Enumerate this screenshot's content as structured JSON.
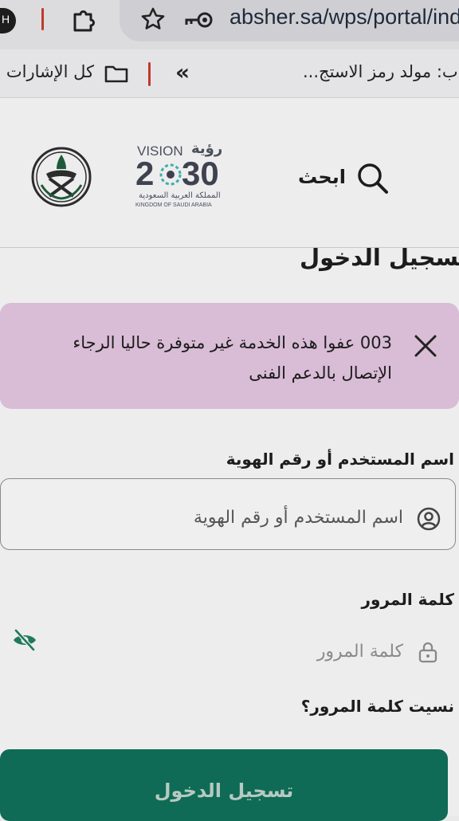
{
  "browser": {
    "profile_letter": "H",
    "url": "absher.sa/wps/portal/indi",
    "bookmarks_all_label": "كل الإشارات ا",
    "bookmark_item": "ب: مولد رمز الاستج..."
  },
  "header": {
    "search_label": "ابحث",
    "vision_latin": "VISION",
    "vision_arabic": "رؤية",
    "vision_year_left": "2",
    "vision_year_right": "30",
    "kingdom_arabic": "المملكة العربية السعودية",
    "kingdom_latin": "KINGDOM OF SAUDI ARABIA"
  },
  "login": {
    "title": "تسجيل الدخول",
    "alert_line1": "003 عفوا هذه الخدمة غير متوفرة حاليا الرجاء",
    "alert_line2": "الإتصال بالدعم الفنى",
    "username_label": "اسم المستخدم أو رقم الهوية",
    "username_placeholder": "اسم المستخدم أو رقم الهوية",
    "password_label": "كلمة المرور",
    "password_placeholder": "كلمة المرور",
    "forgot_password": "نسيت كلمة المرور؟",
    "submit_label": "تسجيل الدخول"
  },
  "colors": {
    "accent_green": "#0f6b55",
    "alert_bg": "#d9bcd6",
    "url_bar_bg": "#cfcfd3"
  }
}
